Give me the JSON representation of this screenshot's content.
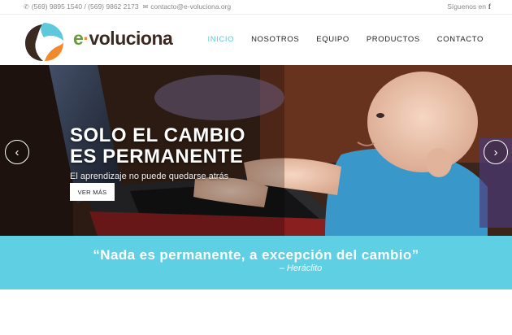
{
  "topbar": {
    "phones": "(569) 9895 1540 / (569) 9862 2173",
    "email": "contacto@e-voluciona.org",
    "follow_label": "Síguenos en"
  },
  "brand": {
    "logo_name": "e-voluciona",
    "prefix": "e",
    "dot": "·",
    "rest": "voluciona"
  },
  "nav": {
    "items": [
      {
        "label": "INICIO",
        "active": true
      },
      {
        "label": "NOSOTROS",
        "active": false
      },
      {
        "label": "EQUIPO",
        "active": false
      },
      {
        "label": "PRODUCTOS",
        "active": false
      },
      {
        "label": "CONTACTO",
        "active": false
      }
    ]
  },
  "hero": {
    "title_line1": "SOLO EL CAMBIO",
    "title_line2": "ES PERMANENTE",
    "subtitle": "El aprendizaje no puede quedarse atrás",
    "button_label": "VER MÁS",
    "prev_icon": "chevron-left-icon",
    "next_icon": "chevron-right-icon"
  },
  "quote": {
    "text": "“Nada es permanente, a excepción del cambio”",
    "author": "– Heráclito"
  },
  "colors": {
    "accent": "#5ec8dd",
    "quote_band": "#5fcfe3",
    "brand_dark": "#3a2a22",
    "brand_green": "#6b9a3a",
    "brand_orange": "#f08a2c"
  }
}
